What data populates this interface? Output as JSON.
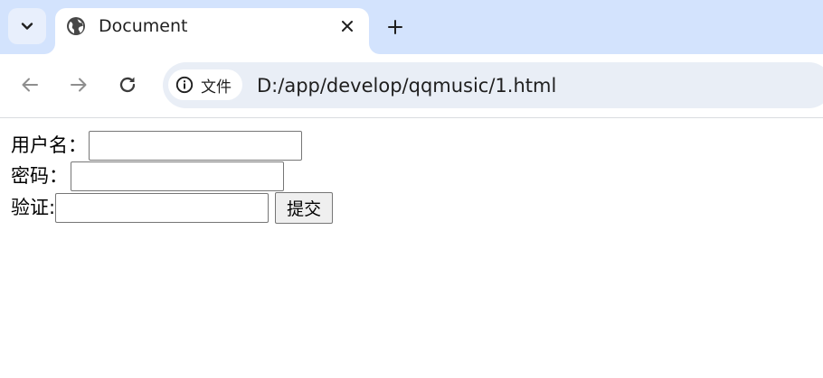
{
  "browser": {
    "tab": {
      "title": "Document",
      "favicon": "globe-icon"
    },
    "tab_search_icon": "chevron-down-icon",
    "tab_close_icon": "close-icon",
    "new_tab_icon": "plus-icon",
    "nav": {
      "back_icon": "arrow-left-icon",
      "forward_icon": "arrow-right-icon",
      "reload_icon": "reload-icon"
    },
    "omnibox": {
      "site_info_icon": "info-icon",
      "site_info_label": "文件",
      "url": "D:/app/develop/qqmusic/1.html"
    },
    "colors": {
      "tabstrip_bg": "#d3e3fd",
      "omnibox_bg": "#e9eef6"
    }
  },
  "page": {
    "form": {
      "username_label": "用户名：",
      "username_value": "",
      "password_label": "密码：",
      "password_value": "",
      "captcha_label": "验证:",
      "captcha_value": "",
      "submit_label": "提交"
    }
  }
}
